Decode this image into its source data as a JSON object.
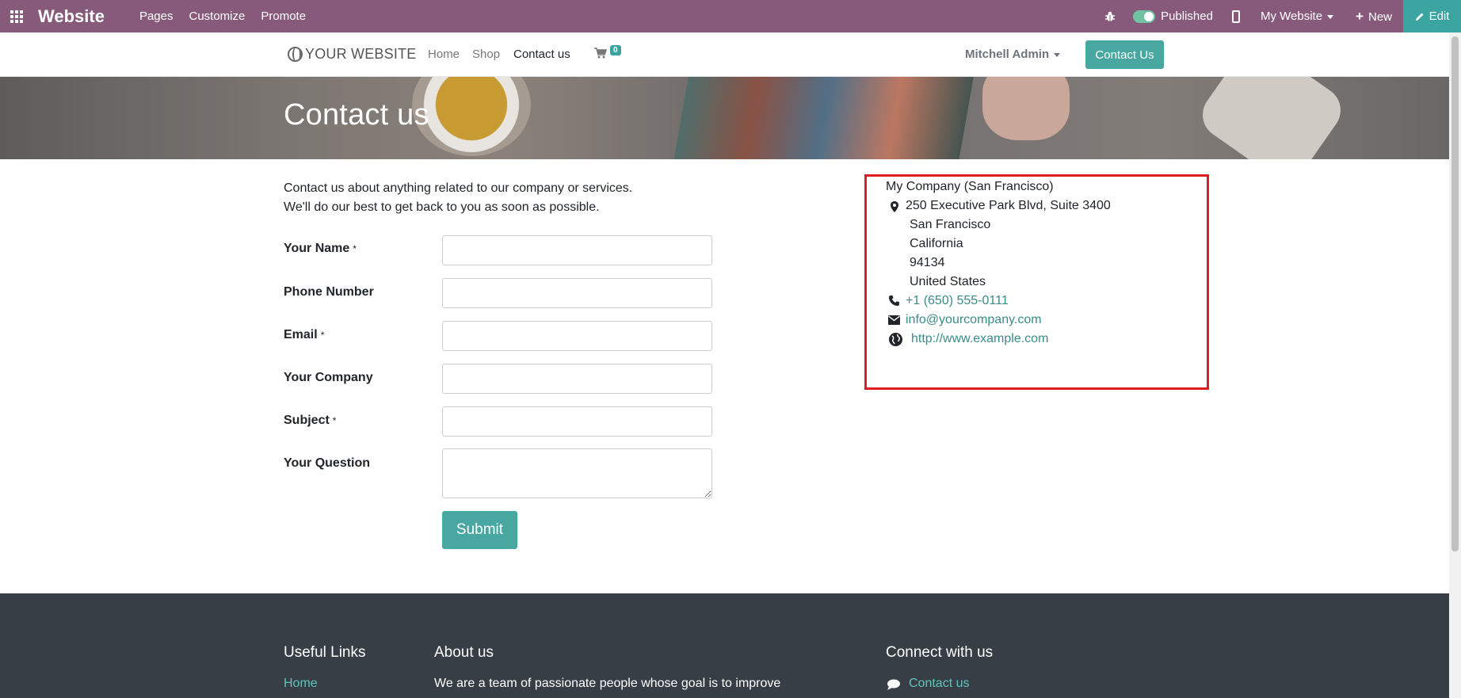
{
  "adminbar": {
    "app_name": "Website",
    "menu": [
      "Pages",
      "Customize",
      "Promote"
    ],
    "published_label": "Published",
    "website_selector": "My Website",
    "new_label": "New",
    "edit_label": "Edit",
    "color": "#875a7b",
    "accent": "#3ca4a0"
  },
  "header": {
    "logo_text": "YOUR WEBSITE",
    "nav": [
      "Home",
      "Shop",
      "Contact us"
    ],
    "active_nav": "Contact us",
    "cart_count": "0",
    "user": "Mitchell Admin",
    "cta": "Contact Us"
  },
  "hero": {
    "title": "Contact us"
  },
  "intro": {
    "line1": "Contact us about anything related to our company or services.",
    "line2": "We'll do our best to get back to you as soon as possible."
  },
  "form": {
    "fields": [
      {
        "label": "Your Name",
        "required": "*",
        "value": ""
      },
      {
        "label": "Phone Number",
        "required": "",
        "value": ""
      },
      {
        "label": "Email",
        "required": "*",
        "value": ""
      },
      {
        "label": "Your Company",
        "required": "",
        "value": ""
      },
      {
        "label": "Subject",
        "required": "*",
        "value": ""
      },
      {
        "label": "Your Question",
        "required": "",
        "value": ""
      }
    ],
    "submit_label": "Submit"
  },
  "company": {
    "name": "My Company (San Francisco)",
    "street": "250 Executive Park Blvd, Suite 3400",
    "city": "San Francisco",
    "state": "California",
    "zip": "94134",
    "country": "United States",
    "phone": "+1 (650) 555-0111",
    "email": "info@yourcompany.com",
    "website": "http://www.example.com"
  },
  "footer": {
    "useful_links_title": "Useful Links",
    "useful_links_first": "Home",
    "about_title": "About us",
    "about_text": "We are a team of passionate people whose goal is to improve",
    "connect_title": "Connect with us",
    "connect_first": "Contact us"
  }
}
